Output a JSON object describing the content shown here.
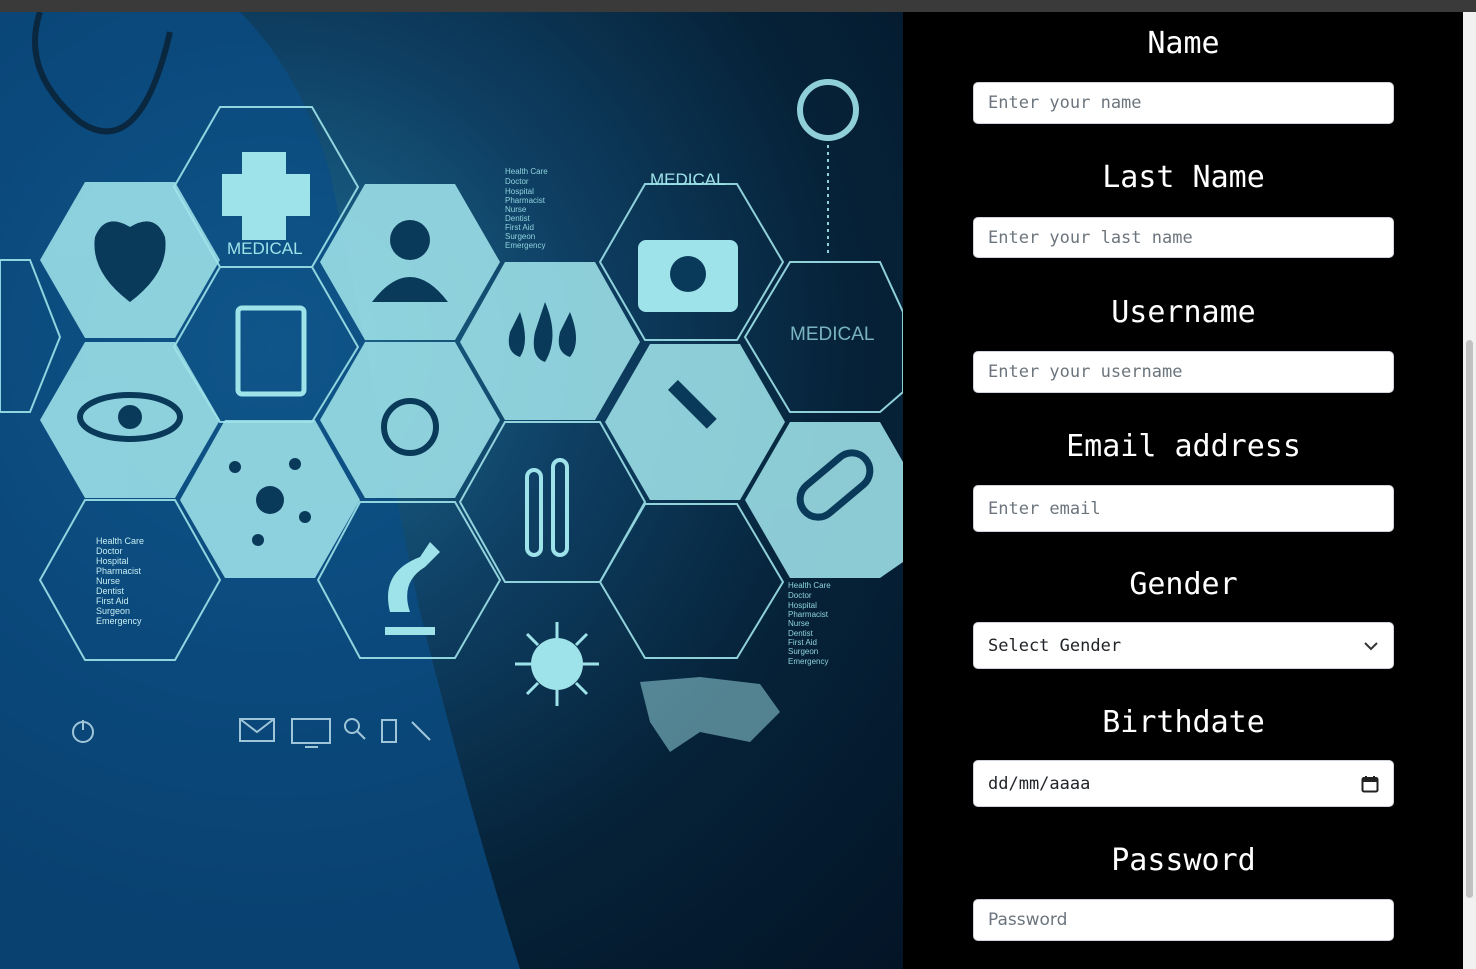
{
  "hero": {
    "hex_labels": [
      "MEDICAL",
      "MEDICAL",
      "MEDICAL"
    ],
    "text_list": [
      "Health Care",
      "Doctor",
      "Hospital",
      "Pharmacist",
      "Nurse",
      "Dentist",
      "First Aid",
      "Surgeon",
      "Emergency"
    ],
    "accent": "#9fe3ea"
  },
  "form": {
    "name": {
      "label": "Name",
      "placeholder": "Enter your name"
    },
    "last_name": {
      "label": "Last Name",
      "placeholder": "Enter your last name"
    },
    "username": {
      "label": "Username",
      "placeholder": "Enter your username"
    },
    "email": {
      "label": "Email address",
      "placeholder": "Enter email"
    },
    "gender": {
      "label": "Gender",
      "selected": "Select Gender"
    },
    "birthdate": {
      "label": "Birthdate",
      "value": "dd/mm/aaaa"
    },
    "password": {
      "label": "Password",
      "placeholder": "Password"
    }
  }
}
